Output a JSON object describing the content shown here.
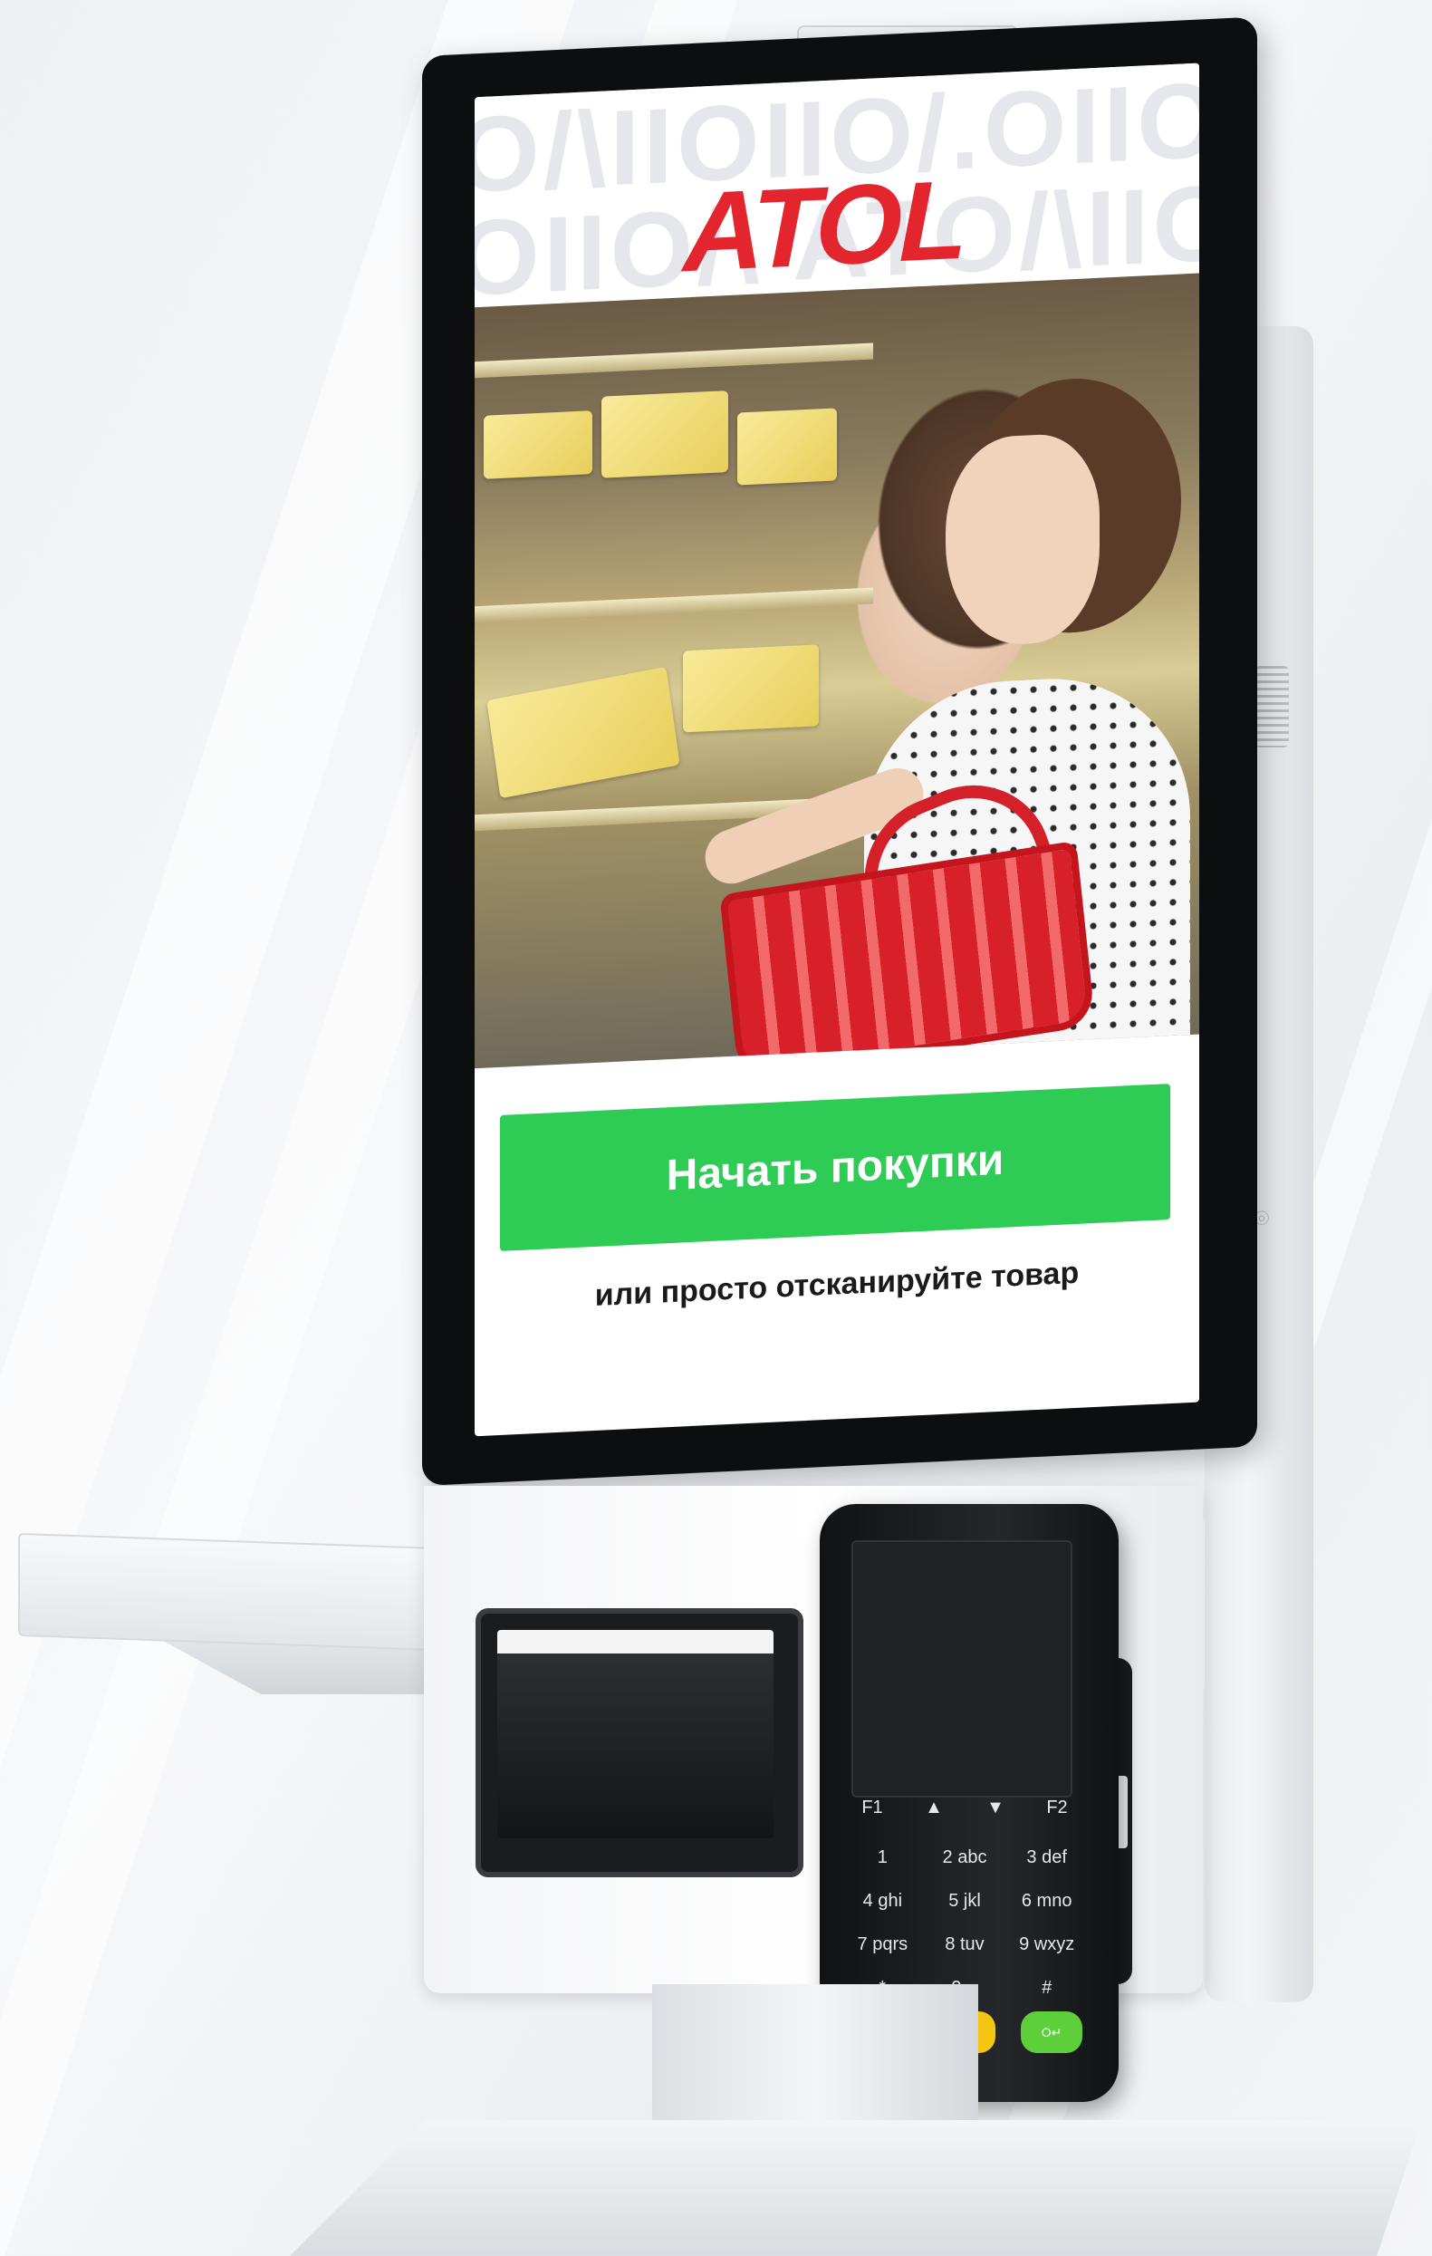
{
  "screen": {
    "brand_logo": "ATOL",
    "pattern_row_1": "O/\\IIOIIO/.OIIO",
    "pattern_row_2": "OIIO/\\ ATO/\\IIO/.",
    "cta_label": "Начать покупки",
    "hint_text": "или просто отсканируйте товар"
  },
  "terminal": {
    "keys": [
      "1",
      "2 abc",
      "3 def",
      "4 ghi",
      "5 jkl",
      "6 mno",
      "7 pqrs",
      "8 tuv",
      "9 wxyz",
      "*",
      "0 ␣",
      "#"
    ],
    "nav_keys": [
      "F1",
      "▲",
      "▼",
      "F2"
    ],
    "function_keys": [
      {
        "label": "⏻ ✕",
        "color": "#e0282f"
      },
      {
        "label": "←",
        "color": "#f3c612"
      },
      {
        "label": "O↵",
        "color": "#5ccf3a"
      }
    ]
  },
  "colors": {
    "brand_red": "#e3262d",
    "cta_green": "#2ecc55",
    "bezel": "#0d0e10"
  }
}
